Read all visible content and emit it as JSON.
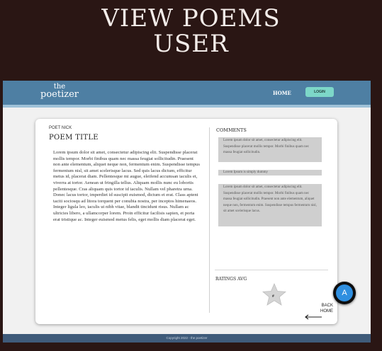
{
  "slide": {
    "title_line1": "VIEW POEMS",
    "title_line2": "USER"
  },
  "navbar": {
    "logo_top": "the",
    "logo_bottom": "poetizer",
    "home_label": "HOME",
    "login_label": "LOGIN"
  },
  "poem": {
    "poet_nick": "POET NICK",
    "title": "POEM TITLE",
    "body": "Lorem ipsum dolor sit amet, consectetur adipiscing elit. Suspendisse placerat mollis tempor. Morbi finibus quam nec massa feugiat sollicitudin. Praesent non ante elementum, aliquet neque non, fermentum enim. Suspendisse tempus fermentum nisl, sit amet scelerisque lacus. Sed quis lacus dictum, efficitur metus id, placerat diam. Pellentesque mi augue, eleifend accumsan iaculis et, viverra at tortor. Aenean ut fringilla tellus. Aliquam mollis nunc eu lobortis pellentesque. Cras aliquam quis tortor id iaculis. Nullam vel pharetra urna. Donec lacus tortor, imperdiet id suscipit euismod, dictum et erat. Class aptent taciti sociosqu ad litora torquent per conubia nostra, per inceptos himenaeos. Integer ligula leo, iaculis ut nibh vitae, blandit tincidunt risus. Nullam ac ultricies libero, a ullamcorper lorem. Proin efficitur facilisis sapien, et porta erat tristique ac. Integer euismod metus felis, eget mollis diam placerat eget."
  },
  "comments": {
    "label": "COMMENTS",
    "items": [
      "Lorem ipsum dolor sit amet, consectetur adipiscing elit. Suspendisse placerat mollis tempor. Morbi finibus quam nec massa feugiat sollicitudin.",
      "Lorem Ipsum is simply dummy",
      "Lorem ipsum dolor sit amet, consectetur adipiscing elit. Suspendisse placerat mollis tempor. Morbi finibus quam nec massa feugiat sollicitudin. Praesent non ante elementum, aliquet neque non, fermentum enim. Suspendisse tempus fermentum nisl, sit amet scelerisque lacus."
    ]
  },
  "ratings": {
    "label": "RATINGS AVG",
    "value": "#",
    "star_icon": "star-icon"
  },
  "back": {
    "line1": "BACK",
    "line2": "HOME",
    "icon": "arrow-left-icon"
  },
  "footer": {
    "text": "Copyright 2022 - the poetizer"
  },
  "fab": {
    "label": "A"
  },
  "colors": {
    "background": "#2a1614",
    "navbar": "#4e7fa3",
    "login_button": "#7dd7c8",
    "footer": "#3f5b7a",
    "fab": "#2f8fe0"
  }
}
